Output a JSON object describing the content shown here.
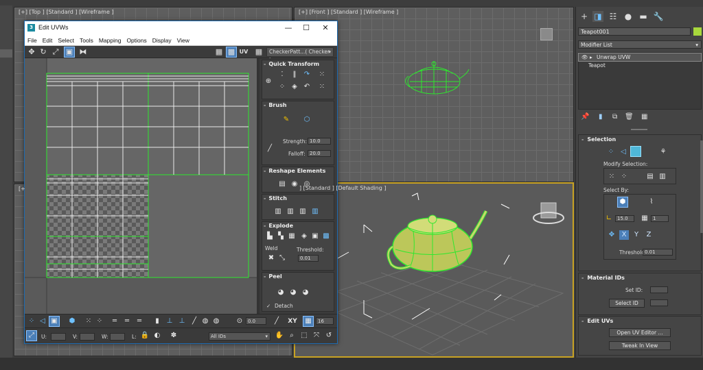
{
  "viewports": {
    "top": {
      "label": "[+] [Top ] [Standard ] [Wireframe ]"
    },
    "front": {
      "label": "[+] [Front ] [Standard ] [Wireframe ]"
    },
    "left": {
      "label": "[+"
    },
    "perspective": {
      "label": "] [Standard ] [Default Shading ]"
    }
  },
  "uvw_window": {
    "title": "Edit UVWs",
    "app_icon": "3",
    "window_buttons": {
      "minimize": "—",
      "maximize": "☐",
      "close": "✕"
    },
    "menu": [
      "File",
      "Edit",
      "Select",
      "Tools",
      "Mapping",
      "Options",
      "Display",
      "View"
    ],
    "toolbar": {
      "uv_label": "UV",
      "checker_dropdown": "CheckerPatt...( Checker )"
    },
    "rollouts": {
      "quick_transform": {
        "title": "Quick Transform"
      },
      "brush": {
        "title": "Brush",
        "strength_label": "Strength:",
        "strength_value": "10.0",
        "falloff_label": "Falloff:",
        "falloff_value": "20.0"
      },
      "reshape": {
        "title": "Reshape Elements"
      },
      "stitch": {
        "title": "Stitch"
      },
      "explode": {
        "title": "Explode",
        "weld_label": "Weld",
        "threshold_label": "Threshold:",
        "threshold_value": "0.01"
      },
      "peel": {
        "title": "Peel",
        "detach_label": "Detach"
      }
    },
    "bottom_bar": {
      "rotate_value": "0.0",
      "xy_label": "XY",
      "grid_value": "16",
      "u_label": "U:",
      "v_label": "V:",
      "w_label": "W:",
      "l_label": "L:",
      "ids_dropdown": "All IDs"
    }
  },
  "command_panel": {
    "object_name": "Teapot001",
    "object_color": "#a8d83c",
    "modifier_list": "Modifier List",
    "stack": [
      {
        "label": "Unwrap UVW"
      },
      {
        "label": "Teapot"
      }
    ],
    "selection": {
      "title": "Selection",
      "modify_selection_label": "Modify Selection:",
      "select_by_label": "Select By:",
      "angle_value": "15.0",
      "count_value": "1",
      "y_label": "Y",
      "z_label": "Z",
      "threshold_label": "Threshold:",
      "threshold_value": "0.01"
    },
    "material_ids": {
      "title": "Material IDs",
      "set_id_label": "Set ID:",
      "select_id_button": "Select ID"
    },
    "edit_uvs": {
      "title": "Edit UVs",
      "open_editor_button": "Open UV Editor ...",
      "tweak_button": "Tweak In View"
    }
  },
  "colors": {
    "wire_green": "#2ee82e",
    "teapot_yellow": "#c8d66a",
    "active_viewport": "#c9a323",
    "accent_blue": "#4b7fb8"
  }
}
